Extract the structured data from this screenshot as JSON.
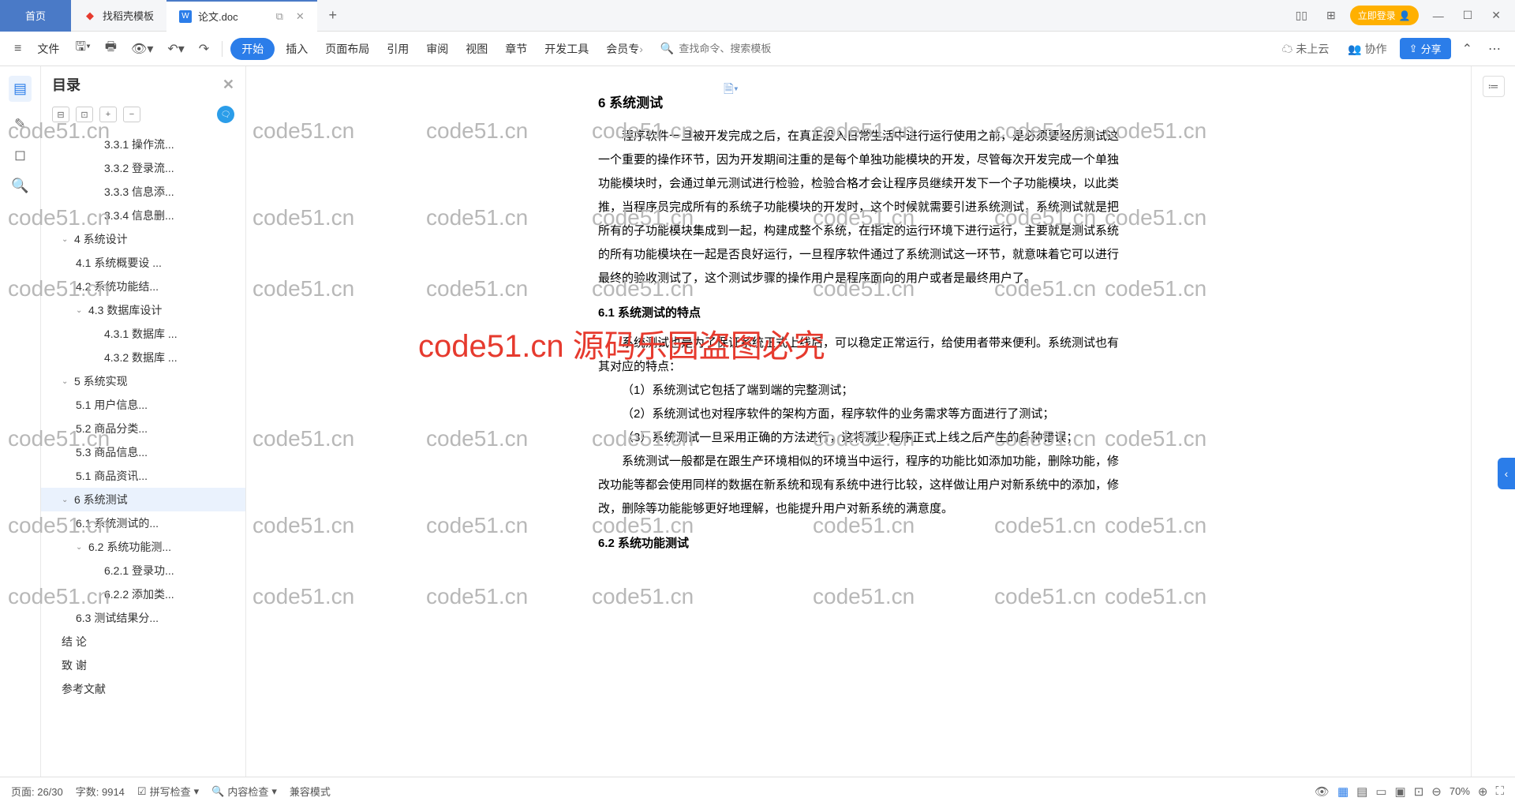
{
  "tabs": {
    "home": "首页",
    "template": "找稻壳模板",
    "doc": "论文.doc"
  },
  "login": "立即登录",
  "toolbar": {
    "file": "文件",
    "start": "开始",
    "insert": "插入",
    "layout": "页面布局",
    "ref": "引用",
    "review": "审阅",
    "view": "视图",
    "chapter": "章节",
    "devtools": "开发工具",
    "member": "会员专",
    "search_ph": "查找命令、搜索模板",
    "cloud": "未上云",
    "collab": "协作",
    "share": "分享"
  },
  "outline": {
    "title": "目录",
    "items": [
      {
        "lv": 4,
        "t": "3.3.1 操作流..."
      },
      {
        "lv": 4,
        "t": "3.3.2 登录流..."
      },
      {
        "lv": 4,
        "t": "3.3.3 信息添..."
      },
      {
        "lv": 4,
        "t": "3.3.4 信息删..."
      },
      {
        "lv": 1,
        "t": "4  系统设计",
        "chev": "v"
      },
      {
        "lv": 2,
        "t": "4.1 系统概要设 ..."
      },
      {
        "lv": 2,
        "t": "4.2 系统功能结..."
      },
      {
        "lv": 2,
        "t": "4.3 数据库设计",
        "chev": "v"
      },
      {
        "lv": 4,
        "t": "4.3.1 数据库 ..."
      },
      {
        "lv": 4,
        "t": "4.3.2 数据库 ..."
      },
      {
        "lv": 1,
        "t": "5  系统实现",
        "chev": "v"
      },
      {
        "lv": 2,
        "t": "5.1 用户信息..."
      },
      {
        "lv": 2,
        "t": "5.2 商品分类..."
      },
      {
        "lv": 2,
        "t": "5.3 商品信息..."
      },
      {
        "lv": 2,
        "t": "5.1 商品资讯..."
      },
      {
        "lv": 1,
        "t": "6  系统测试",
        "chev": "v",
        "active": true
      },
      {
        "lv": 2,
        "t": "6.1 系统测试的..."
      },
      {
        "lv": 2,
        "t": "6.2 系统功能测...",
        "chev": "v"
      },
      {
        "lv": 4,
        "t": "6.2.1 登录功..."
      },
      {
        "lv": 4,
        "t": "6.2.2 添加类..."
      },
      {
        "lv": 2,
        "t": "6.3 测试结果分..."
      },
      {
        "lv": 1,
        "t": "结  论"
      },
      {
        "lv": 1,
        "t": "致  谢"
      },
      {
        "lv": 1,
        "t": "参考文献"
      }
    ]
  },
  "doc": {
    "h1": "6  系统测试",
    "p1": "程序软件一旦被开发完成之后，在真正投入日常生活中进行运行使用之前，是必须要经历测试这一个重要的操作环节，因为开发期间注重的是每个单独功能模块的开发，尽管每次开发完成一个单独功能模块时，会通过单元测试进行检验，检验合格才会让程序员继续开发下一个子功能模块，以此类推，当程序员完成所有的系统子功能模块的开发时，这个时候就需要引进系统测试，系统测试就是把所有的子功能模块集成到一起，构建成整个系统，在指定的运行环境下进行运行，主要就是测试系统的所有功能模块在一起是否良好运行，一旦程序软件通过了系统测试这一环节，就意味着它可以进行最终的验收测试了，这个测试步骤的操作用户是程序面向的用户或者是最终用户了。",
    "h2a": "6.1  系统测试的特点",
    "p2": "系统测试也是为了保证系统正式上线后，可以稳定正常运行，给使用者带来便利。系统测试也有其对应的特点：",
    "li1": "（1）系统测试它包括了端到端的完整测试；",
    "li2": "（2）系统测试也对程序软件的架构方面，程序软件的业务需求等方面进行了测试；",
    "li3": "（3）系统测试一旦采用正确的方法进行，这将减少程序正式上线之后产生的各种错误；",
    "p3": "系统测试一般都是在跟生产环境相似的环境当中运行，程序的功能比如添加功能，删除功能，修改功能等都会使用同样的数据在新系统和现有系统中进行比较，这样做让用户对新系统中的添加，修改，删除等功能能够更好地理解，也能提升用户对新系统的满意度。",
    "h2b": "6.2  系统功能测试"
  },
  "status": {
    "page": "页面: 26/30",
    "words": "字数: 9914",
    "spell": "拼写检查",
    "content": "内容检查",
    "compat": "兼容模式",
    "zoom": "70%"
  },
  "watermark": "code51.cn",
  "watermark_red": "code51.cn 源码乐园盗图必究"
}
